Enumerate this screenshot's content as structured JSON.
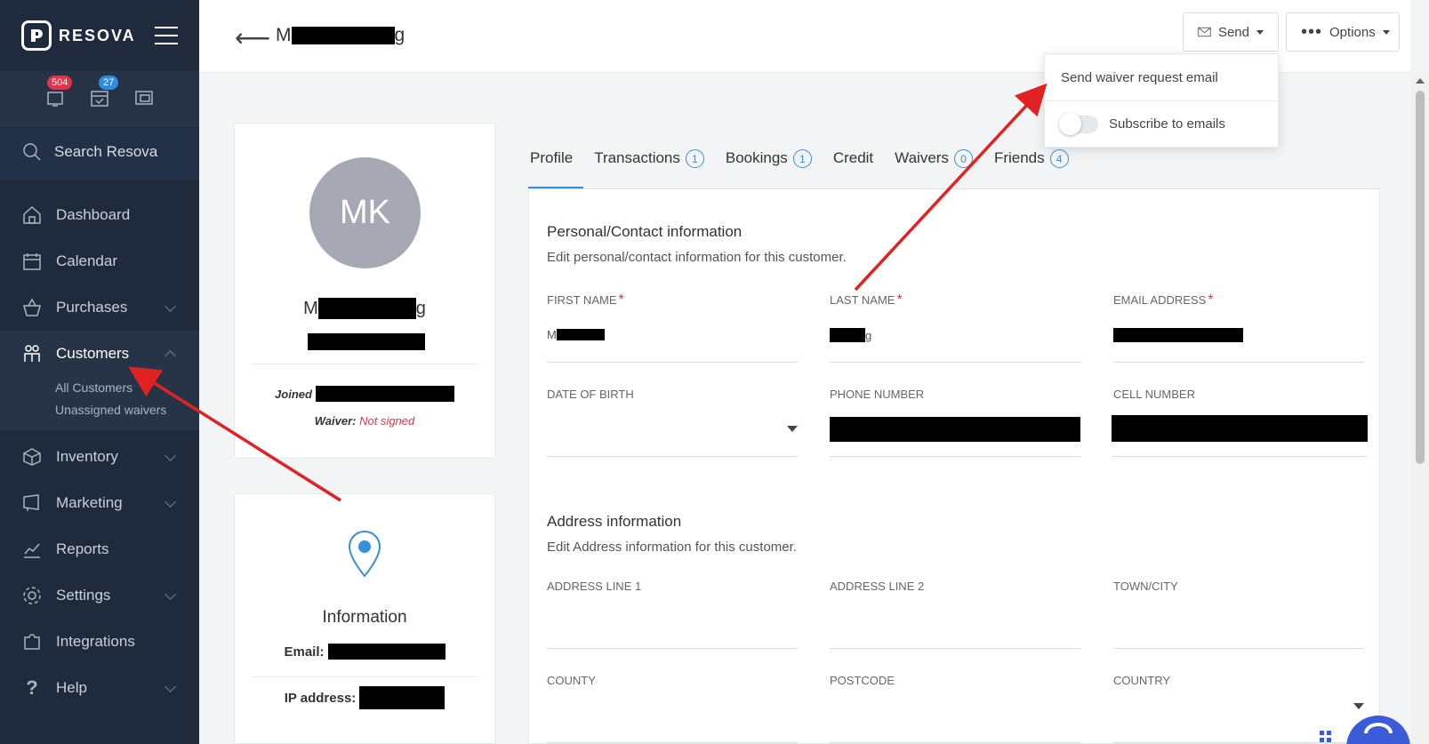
{
  "brand": {
    "name": "RESOVA"
  },
  "notifications": [
    {
      "icon": "bell-icon",
      "count": "504",
      "color": "#e2334c"
    },
    {
      "icon": "calendar-check-icon",
      "count": "27",
      "color": "#2d8be0"
    },
    {
      "icon": "windows-icon",
      "count": ""
    }
  ],
  "search": {
    "label": "Search Resova"
  },
  "nav": {
    "dashboard": "Dashboard",
    "calendar": "Calendar",
    "purchases": "Purchases",
    "customers": "Customers",
    "customers_sub": [
      "All Customers",
      "Unassigned waivers"
    ],
    "inventory": "Inventory",
    "marketing": "Marketing",
    "reports": "Reports",
    "settings": "Settings",
    "integrations": "Integrations",
    "help": "Help"
  },
  "header": {
    "back": "⟵",
    "title_start": "M",
    "title_end": "g",
    "send_label": "Send",
    "options_label": "Options"
  },
  "send_menu": {
    "item1": "Send waiver request email",
    "item2": "Subscribe to emails"
  },
  "profile": {
    "initials": "MK",
    "name_start": "M",
    "name_end": "g",
    "joined_label": "Joined",
    "waiver_label": "Waiver:",
    "waiver_status": "Not signed"
  },
  "info": {
    "title": "Information",
    "email_label": "Email:",
    "ip_label": "IP address:"
  },
  "tabs": [
    {
      "label": "Profile",
      "count": ""
    },
    {
      "label": "Transactions",
      "count": "1"
    },
    {
      "label": "Bookings",
      "count": "1"
    },
    {
      "label": "Credit",
      "count": ""
    },
    {
      "label": "Waivers",
      "count": "0"
    },
    {
      "label": "Friends",
      "count": "4"
    }
  ],
  "personal": {
    "title": "Personal/Contact information",
    "subtitle": "Edit personal/contact information for this customer.",
    "first_name_label": "FIRST NAME",
    "first_name_start": "M",
    "last_name_label": "LAST NAME",
    "last_name_end": "g",
    "email_label": "EMAIL ADDRESS",
    "dob_label": "DATE OF BIRTH",
    "phone_label": "PHONE NUMBER",
    "cell_label": "CELL NUMBER",
    "required_mark": "*"
  },
  "address": {
    "title": "Address information",
    "subtitle": "Edit Address information for this customer.",
    "line1_label": "ADDRESS LINE 1",
    "line2_label": "ADDRESS LINE 2",
    "town_label": "TOWN/CITY",
    "county_label": "COUNTY",
    "postcode_label": "POSTCODE",
    "country_label": "COUNTRY"
  },
  "colors": {
    "sidebar": "#1f2a3d",
    "accent": "#3490dc",
    "danger": "#e2334c",
    "annotation": "#e22222"
  }
}
